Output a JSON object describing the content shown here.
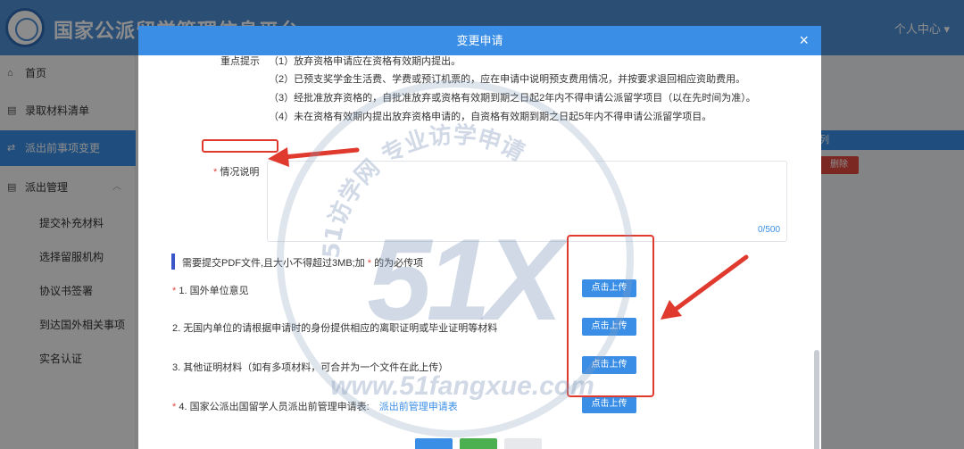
{
  "header": {
    "site_title": "国家公派留学管理信息平台",
    "user_center": "个人中心 ▾"
  },
  "sidebar": {
    "items": [
      {
        "label": "首页",
        "icon": "home-icon"
      },
      {
        "label": "录取材料清单",
        "icon": "document-icon"
      },
      {
        "label": "派出前事项变更",
        "icon": "swap-icon"
      },
      {
        "label": "派出管理",
        "icon": "list-icon"
      }
    ],
    "sub_items": [
      {
        "label": "提交补充材料"
      },
      {
        "label": "选择留服机构"
      },
      {
        "label": "协议书签署"
      },
      {
        "label": "到达国外相关事项"
      },
      {
        "label": "实名认证"
      }
    ]
  },
  "background": {
    "table_header": "列",
    "delete_label": "删除"
  },
  "modal": {
    "title": "变更申请",
    "close_label": "×",
    "tips_label": "重点提示",
    "tips": [
      "（1）放弃资格申请应在资格有效期内提出。",
      "（2）已预支奖学金生活费、学费或预订机票的，应在申请中说明预支费用情况，并按要求退回相应资助费用。",
      "（3）经批准放弃资格的，自批准放弃或资格有效期到期之日起2年内不得申请公派留学项目（以在先时间为准）。",
      "（4）未在资格有效期内提出放弃资格申请的，自资格有效期到期之日起5年内不得申请公派留学项目。"
    ],
    "remark": {
      "required_mark": "*",
      "label": "情况说明",
      "value": "",
      "counter": "0/500"
    },
    "upload_note": {
      "prefix": "需要提交PDF文件,且大小不得超过3MB;加",
      "mark": "*",
      "suffix": "的为必传项"
    },
    "files": [
      {
        "required": "*",
        "label": "1. 国外单位意见",
        "link": "",
        "button": "点击上传"
      },
      {
        "required": "",
        "label": "2. 无国内单位的请根据申请时的身份提供相应的离职证明或毕业证明等材料",
        "link": "",
        "button": "点击上传"
      },
      {
        "required": "",
        "label": "3. 其他证明材料（如有多项材料，可合并为一个文件在此上传）",
        "link": "",
        "button": "点击上传"
      },
      {
        "required": "*",
        "label": "4. 国家公派出国留学人员派出前管理申请表:",
        "link": "派出前管理申请表",
        "button": "点击上传"
      }
    ]
  },
  "watermark": {
    "brand": "51X",
    "url": "www.51fangxue.com",
    "arc_text": "51访学网 专业访学申请"
  },
  "colors": {
    "primary": "#3a8ee6",
    "annotation_red": "#e03a2f",
    "required_red": "#e04a3f"
  }
}
